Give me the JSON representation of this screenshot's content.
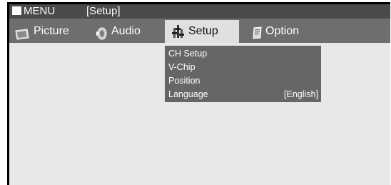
{
  "title_bar": {
    "menu_label": "MENU",
    "breadcrumb": "[Setup]"
  },
  "tabs": [
    {
      "label": "Picture",
      "icon": "picture-icon",
      "active": false
    },
    {
      "label": "Audio",
      "icon": "audio-icon",
      "active": false
    },
    {
      "label": "Setup",
      "icon": "setup-icon",
      "active": true
    },
    {
      "label": "Option",
      "icon": "option-icon",
      "active": false
    }
  ],
  "submenu": {
    "items": [
      {
        "label": "CH Setup",
        "value": ""
      },
      {
        "label": "V-Chip",
        "value": ""
      },
      {
        "label": "Position",
        "value": ""
      },
      {
        "label": "Language",
        "value": "[English]"
      }
    ]
  },
  "colors": {
    "title_bar": "#4a4a4a",
    "tab_bar": "#6e6e6e",
    "active_tab": "#e0e0e0",
    "submenu": "#666666",
    "screen_background": "#e8e8e8"
  }
}
